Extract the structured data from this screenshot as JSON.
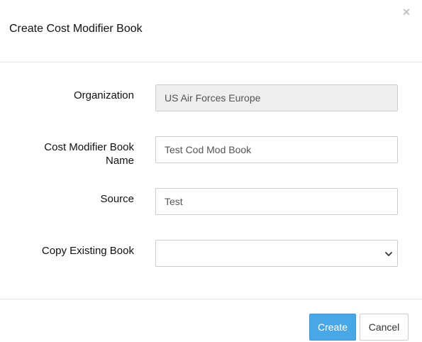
{
  "modal": {
    "title": "Create Cost Modifier Book",
    "close_glyph": "×"
  },
  "form": {
    "organization": {
      "label": "Organization",
      "value": "US Air Forces Europe"
    },
    "book_name": {
      "label_line1": "Cost Modifier Book",
      "label_line2": "Name",
      "value": "Test Cod Mod Book"
    },
    "source": {
      "label": "Source",
      "value": "Test"
    },
    "copy_existing": {
      "label": "Copy Existing Book",
      "value": ""
    }
  },
  "footer": {
    "create_label": "Create",
    "cancel_label": "Cancel"
  },
  "colors": {
    "primary": "#4aa7e6",
    "readonly_bg": "#eeeeee",
    "border": "#cccccc"
  },
  "icons": {
    "close": "close-icon",
    "select_caret": "chevron-down-icon"
  }
}
